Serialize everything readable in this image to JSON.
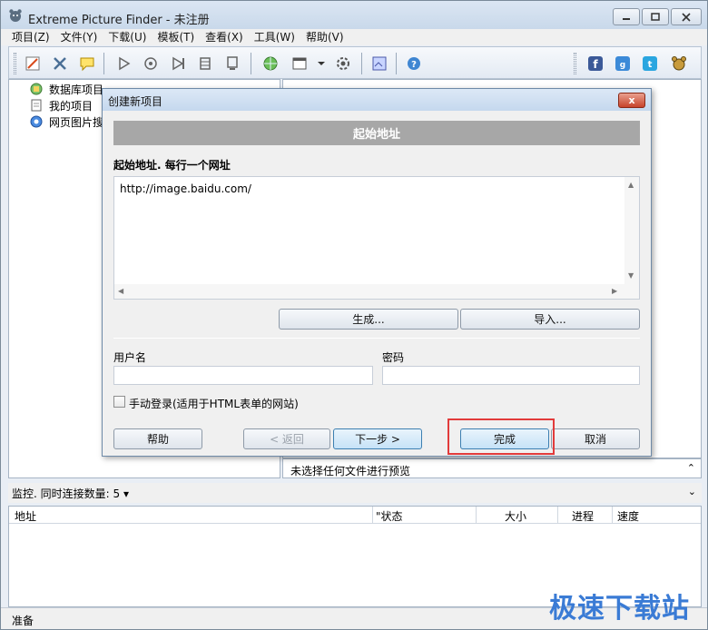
{
  "window": {
    "title": "Extreme Picture Finder - 未注册"
  },
  "menu": [
    "项目(Z)",
    "文件(Y)",
    "下载(U)",
    "模板(T)",
    "查看(X)",
    "工具(W)",
    "帮助(V)"
  ],
  "tree": {
    "items": [
      {
        "label": "数据库项目",
        "icon": "database-icon"
      },
      {
        "label": "我的项目",
        "icon": "document-icon"
      },
      {
        "label": "网页图片搜",
        "icon": "search-globe-icon"
      }
    ]
  },
  "preview": {
    "text": "未选择任何文件进行预览"
  },
  "monitor": {
    "text": "监控. 同时连接数量: 5"
  },
  "downloads": {
    "columns": [
      "地址",
      "\"状态",
      "大小",
      "进程",
      "速度"
    ]
  },
  "status": {
    "text": "准备"
  },
  "watermark": "极速下载站",
  "dialog": {
    "title": "创建新项目",
    "close_label": "x",
    "banner": "起始地址",
    "url_label": "起始地址. 每行一个网址",
    "url_value": "http://image.baidu.com/",
    "generate_label": "生成...",
    "import_label": "导入...",
    "username_label": "用户名",
    "password_label": "密码",
    "manual_login_label": "手动登录(适用于HTML表单的网站)",
    "help_label": "帮助",
    "back_label": "< 返回",
    "next_label": "下一步 >",
    "finish_label": "完成",
    "cancel_label": "取消"
  },
  "colors": {
    "highlight": "#e23b3b",
    "banner": "#a7a7a7",
    "watermark": "#3a7bd5"
  }
}
